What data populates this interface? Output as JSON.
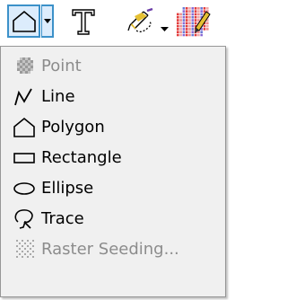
{
  "toolbar": {
    "shape_tool_icon": "polygon-icon",
    "dropdown_icon": "chevron-down-icon",
    "text_tool_icon": "text-icon",
    "draw_tool_icon": "pencil-icon",
    "raster_tool_icon": "raster-seed-icon"
  },
  "menu": {
    "items": [
      {
        "label": "Point",
        "icon": "point-icon",
        "enabled": false
      },
      {
        "label": "Line",
        "icon": "line-icon",
        "enabled": true
      },
      {
        "label": "Polygon",
        "icon": "polygon-icon",
        "enabled": true
      },
      {
        "label": "Rectangle",
        "icon": "rectangle-icon",
        "enabled": true
      },
      {
        "label": "Ellipse",
        "icon": "ellipse-icon",
        "enabled": true
      },
      {
        "label": "Trace",
        "icon": "trace-icon",
        "enabled": true
      },
      {
        "label": "Raster Seeding...",
        "icon": "raster-seeding-icon",
        "enabled": false
      }
    ]
  },
  "colors": {
    "selected_border": "#3c91c9",
    "selected_fill": "#dcecfc",
    "menu_background": "#f0f0f0",
    "disabled_text": "#8c8c8c"
  }
}
